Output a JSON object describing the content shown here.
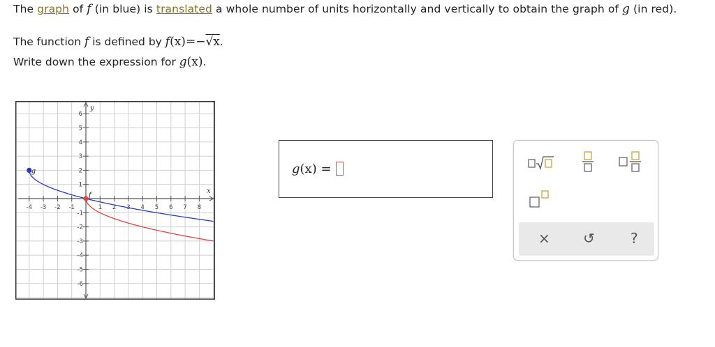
{
  "prompt": {
    "line1_pre": "The",
    "link_graph": "graph",
    "line1_of": "of",
    "f_var": "f",
    "line1_mid": "(in blue) is",
    "link_translated": "translated",
    "line1_post": "a whole number of units horizontally and vertically to obtain the graph of",
    "g_var": "g",
    "line1_end": "(in red).",
    "line2_pre": "The function",
    "line2_mid": "is defined by",
    "f_def_lhs": "f",
    "f_def_arg": "(x)",
    "f_def_eq": "=",
    "f_def_minus": "−",
    "f_def_sqrt": "√x",
    "line2_end": ".",
    "line3_pre": "Write down the expression for",
    "line3_g": "g",
    "line3_arg": "(x)",
    "line3_end": "."
  },
  "graph": {
    "x_axis_label": "x",
    "y_axis_label": "y",
    "x_ticks": [
      "-4",
      "-3",
      "-2",
      "-1",
      "1",
      "2",
      "3",
      "4",
      "5",
      "6",
      "7",
      "8"
    ],
    "y_ticks_pos": [
      "1",
      "2",
      "3",
      "4",
      "5",
      "6"
    ],
    "y_ticks_neg": [
      "-1",
      "-2",
      "-3",
      "-4",
      "-5",
      "-6"
    ],
    "blue_curve_label": "g",
    "red_curve_label": "f",
    "blue_color": "#2a3bbf",
    "red_color": "#e2433f",
    "grid_color": "#cfcfcf"
  },
  "answer": {
    "lhs": "g",
    "arg": "(x)",
    "eq": "="
  },
  "palette": {
    "tools": [
      "square-root-template",
      "fraction-template",
      "mixed-number-template",
      "exponent-template"
    ],
    "actions": {
      "clear": "×",
      "undo": "↺",
      "help": "?"
    },
    "template_color": "#c7a53a"
  }
}
